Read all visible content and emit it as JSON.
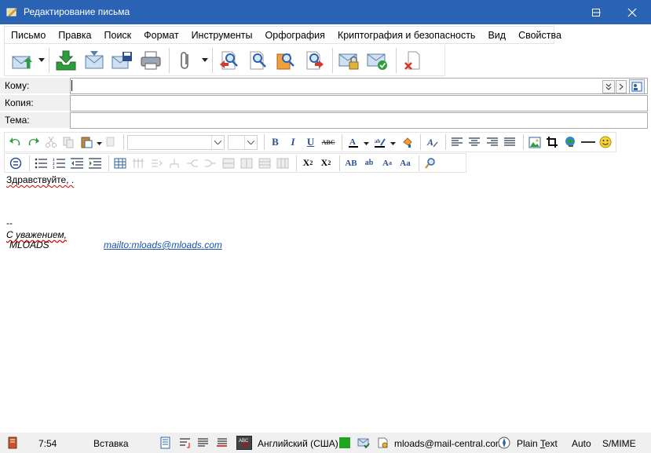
{
  "window": {
    "title": "Редактирование письма"
  },
  "menu": [
    "Письмо",
    "Правка",
    "Поиск",
    "Формат",
    "Инструменты",
    "Орфография",
    "Криптография и безопасность",
    "Вид",
    "Свойства"
  ],
  "fields": {
    "to_label": "Кому:",
    "cc_label": "Копия:",
    "subject_label": "Тема:",
    "to_value": "",
    "cc_value": "",
    "subject_value": ""
  },
  "body": {
    "greeting": "Здравствуйте, .",
    "sig_sep": "--",
    "regards": "С уважением,",
    "name": "MLOADS",
    "email_link": "mailto:mloads@mloads.com"
  },
  "statusbar": {
    "time": "7:54",
    "mode": "Вставка",
    "language": "Английский (США)",
    "account": "mloads@mail-central.com",
    "format_prefix": "Plain ",
    "format_accel": "T",
    "format_suffix": "ext",
    "encoding": "Auto",
    "security": "S/MIME"
  },
  "colors": {
    "titlebar": "#2b63b4",
    "link": "#1a53b0",
    "accent_green": "#2e9e3c"
  }
}
